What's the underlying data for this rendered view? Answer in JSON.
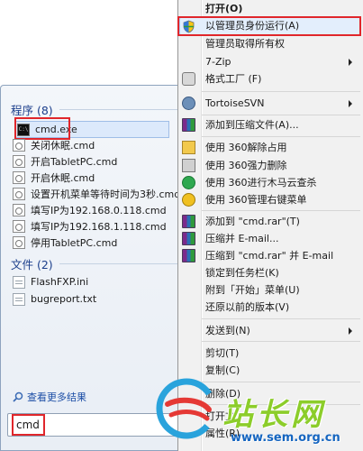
{
  "start_menu": {
    "programs_header": "程序 (8)",
    "programs": [
      {
        "label": "cmd.exe",
        "icon": "console-icon"
      },
      {
        "label": "关闭休眠.cmd",
        "icon": "batch-file-icon"
      },
      {
        "label": "开启TabletPC.cmd",
        "icon": "batch-file-icon"
      },
      {
        "label": "开启休眠.cmd",
        "icon": "batch-file-icon"
      },
      {
        "label": "设置开机菜单等待时间为3秒.cmd",
        "icon": "batch-file-icon"
      },
      {
        "label": "填写IP为192.168.0.118.cmd",
        "icon": "batch-file-icon"
      },
      {
        "label": "填写IP为192.168.1.118.cmd",
        "icon": "batch-file-icon"
      },
      {
        "label": "停用TabletPC.cmd",
        "icon": "batch-file-icon"
      }
    ],
    "files_header": "文件 (2)",
    "files": [
      {
        "label": "FlashFXP.ini",
        "icon": "text-file-icon"
      },
      {
        "label": "bugreport.txt",
        "icon": "text-file-icon"
      }
    ],
    "more_results": "查看更多结果",
    "search_value": "cmd"
  },
  "context_menu": {
    "open": "打开(O)",
    "run_as_admin": "以管理员身份运行(A)",
    "take_ownership": "管理员取得所有权",
    "sevenzip": "7-Zip",
    "format_factory": "格式工厂 (F)",
    "tortoisesvn": "TortoiseSVN",
    "add_to_archive": "添加到压缩文件(A)...",
    "unlock_360": "使用 360解除占用",
    "force_delete_360": "使用 360强力删除",
    "trojan_scan_360": "使用 360进行木马云查杀",
    "manage_menu_360": "使用 360管理右键菜单",
    "add_to_rar": "添加到 \"cmd.rar\"(T)",
    "compress_email": "压缩并 E-mail...",
    "compress_rar_email": "压缩到 \"cmd.rar\" 并 E-mail",
    "pin_taskbar": "锁定到任务栏(K)",
    "pin_start": "附到「开始」菜单(U)",
    "restore_prev": "还原以前的版本(V)",
    "send_to": "发送到(N)",
    "cut": "剪切(T)",
    "copy": "复制(C)",
    "delete": "删除(D)",
    "open_location_partial": "打开文",
    "properties_partial": "属性(R)"
  },
  "watermark": {
    "site_name": "站长网",
    "url": "www.sem.org.cn"
  },
  "colors": {
    "highlight_red": "#e0262b",
    "group_header_blue": "#1c3f8c",
    "watermark_green": "#8ccd2a",
    "watermark_blue": "#1565c0"
  }
}
